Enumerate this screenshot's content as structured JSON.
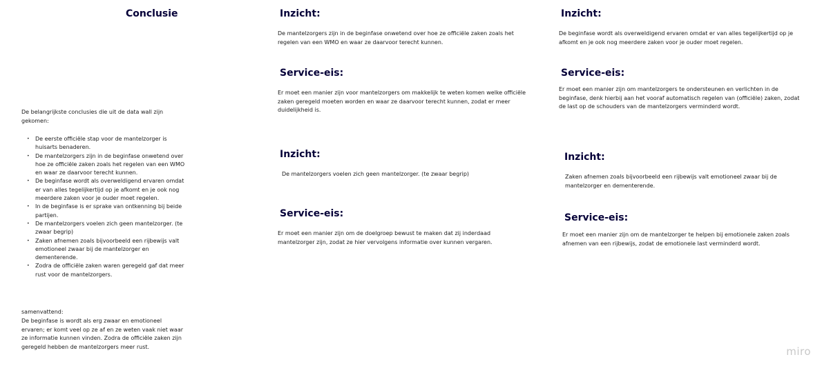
{
  "conclusion": {
    "title": "Conclusie",
    "intro": "De belangrijkste conclusies die uit de data wall zijn gekomen:",
    "items": [
      "De eerste officiële stap voor de mantelzorger is huisarts benaderen.",
      "De mantelzorgers zijn in de beginfase onwetend over hoe ze officiële zaken zoals het regelen van een WMO en waar ze daarvoor terecht kunnen.",
      "De beginfase wordt als overweldigend ervaren omdat er van alles tegelijkertijd op je afkomt en je ook nog meerdere zaken voor je ouder moet regelen.",
      "In de beginfase is er sprake van ontkenning bij beide partijen.",
      "De mantelzorgers voelen zich geen mantelzorger. (te zwaar begrip)",
      "Zaken afnemen zoals bijvoorbeeld een rijbewijs valt emotioneel zwaar bij de mantelzorger en dementerende.",
      "Zodra de officiële zaken waren geregeld gaf dat meer rust voor de mantelzorgers."
    ],
    "summary_label": "samenvattend:",
    "summary": "De beginfase is wordt als erg zwaar en emotioneel ervaren; er komt veel op ze af en ze weten vaak niet waar ze informatie kunnen vinden. Zodra de officiële zaken zijn geregeld hebben de mantelzorgers meer rust."
  },
  "blocks": [
    {
      "insight_title": "Inzicht:",
      "insight": "De mantelzorgers zijn in de beginfase onwetend over hoe ze officiële zaken zoals het regelen van een WMO en waar ze daarvoor terecht kunnen.",
      "requirement_title": "Service-eis:",
      "requirement": "Er moet een manier zijn voor mantelzorgers om makkelijk te weten komen welke officiële zaken geregeld moeten worden en waar ze daarvoor terecht kunnen, zodat er meer duidelijkheid is."
    },
    {
      "insight_title": "Inzicht:",
      "insight": "De beginfase wordt als overweldigend ervaren omdat er van alles tegelijkertijd op je afkomt en je ook nog meerdere zaken voor je ouder moet regelen.",
      "requirement_title": "Service-eis:",
      "requirement": "Er moet een manier zijn om mantelzorgers te ondersteunen en verlichten in de beginfase, denk hierbij aan het vooraf automatisch regelen van (officiële) zaken, zodat de last op de schouders van de mantelzorgers verminderd wordt."
    },
    {
      "insight_title": "Inzicht:",
      "insight": "De mantelzorgers voelen zich geen mantelzorger. (te zwaar begrip)",
      "requirement_title": "Service-eis:",
      "requirement": "Er moet een manier zijn om de doelgroep bewust te maken dat zij inderdaad mantelzorger zijn, zodat ze hier vervolgens informatie over kunnen vergaren."
    },
    {
      "insight_title": "Inzicht:",
      "insight": "Zaken afnemen zoals bijvoorbeeld een rijbewijs valt emotioneel zwaar bij de mantelzorger en dementerende.",
      "requirement_title": "Service-eis:",
      "requirement": "Er moet een manier zijn om de mantelzorger te helpen bij emotionele zaken zoals afnemen van een rijbewijs, zodat de emotionele last verminderd wordt."
    }
  ],
  "watermark": "miro",
  "colors": {
    "background": "#ffffff",
    "heading": "#050038",
    "text": "#1a1a1a",
    "watermark": "#c8c8c8"
  }
}
